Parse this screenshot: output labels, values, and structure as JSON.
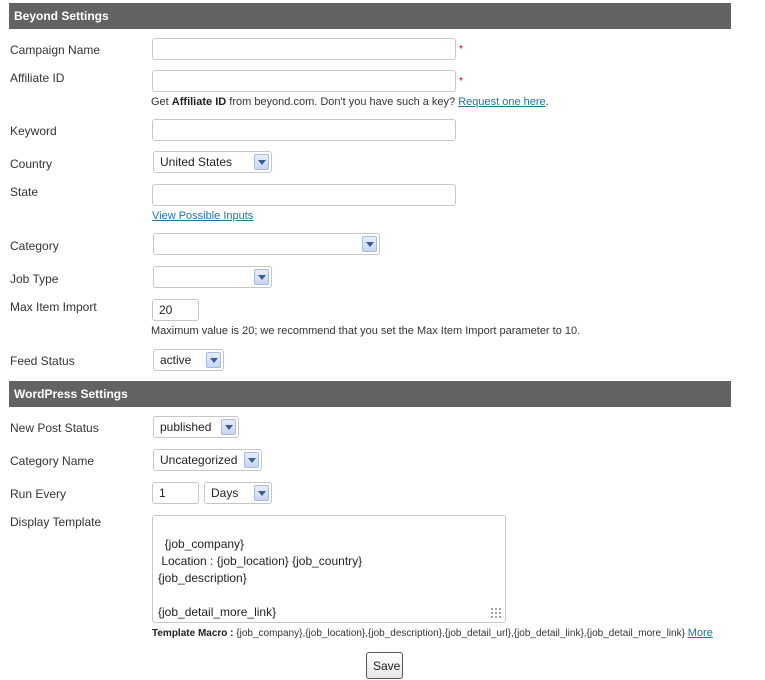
{
  "beyond_settings": {
    "header": "Beyond Settings",
    "campaign_name": {
      "label": "Campaign Name",
      "value": "",
      "required_mark": "*"
    },
    "affiliate_id": {
      "label": "Affiliate ID",
      "value": "",
      "required_mark": "*",
      "note_prefix": "Get ",
      "note_bold": "Affiliate ID",
      "note_middle": " from beyond.com. Don't you have such a key? ",
      "note_link": "Request one here",
      "note_suffix": "."
    },
    "keyword": {
      "label": "Keyword",
      "value": ""
    },
    "country": {
      "label": "Country",
      "selected": "United States"
    },
    "state": {
      "label": "State",
      "value": "",
      "link": "View Possible Inputs"
    },
    "category": {
      "label": "Category",
      "selected": ""
    },
    "job_type": {
      "label": "Job Type",
      "selected": ""
    },
    "max_item_import": {
      "label": "Max Item Import",
      "value": "20",
      "note": "Maximum value is 20; we recommend that you set the Max Item Import parameter to 10."
    },
    "feed_status": {
      "label": "Feed Status",
      "selected": "active"
    }
  },
  "wordpress_settings": {
    "header": "WordPress Settings",
    "new_post_status": {
      "label": "New Post Status",
      "selected": "published"
    },
    "category_name": {
      "label": "Category Name",
      "selected": "Uncategorized"
    },
    "run_every": {
      "label": "Run Every",
      "value": "1",
      "unit": "Days"
    },
    "display_template": {
      "label": "Display Template",
      "value": "{job_company}\n Location : {job_location} {job_country}\n{job_description}\n\n{job_detail_more_link}",
      "macro_label": "Template Macro : ",
      "macro_list": "{job_company},{job_location},{job_description},{job_detail_url},{job_detail_link},{job_detail_more_link}",
      "more_link": "More"
    }
  },
  "save_button": "Save",
  "colors": {
    "header_bg": "#636363",
    "link": "#21759b",
    "required": "#cc0000"
  }
}
